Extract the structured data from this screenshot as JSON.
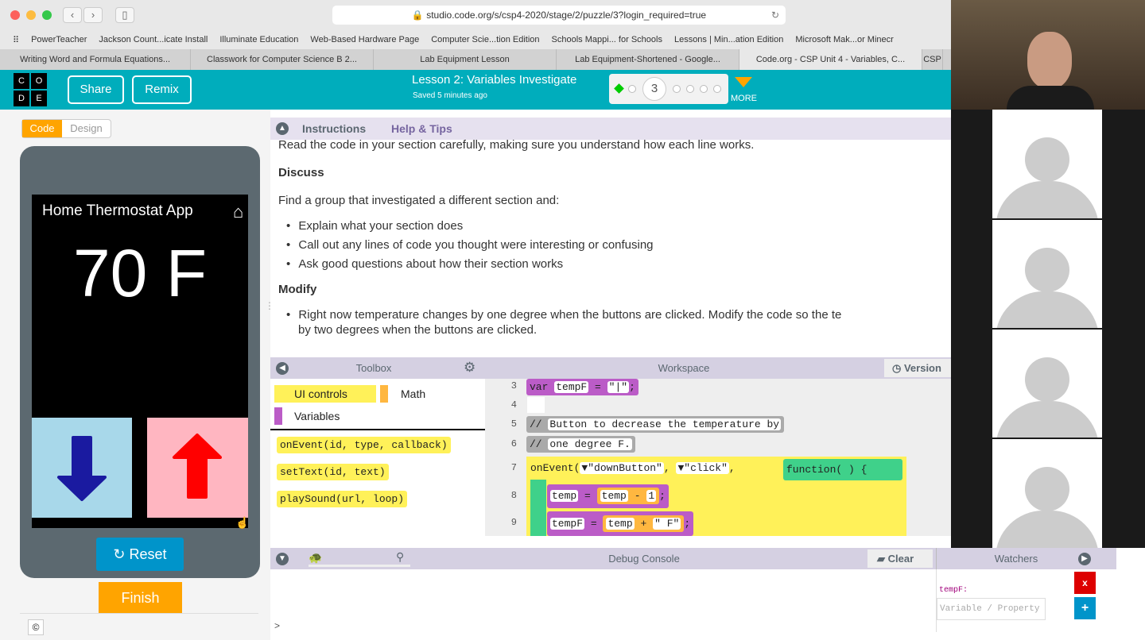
{
  "browser": {
    "url": "studio.code.org/s/csp4-2020/stage/2/puzzle/3?login_required=true",
    "bookmarks": [
      "PowerTeacher",
      "Jackson Count...icate Install",
      "Illuminate Education",
      "Web-Based Hardware Page",
      "Computer Scie...tion Edition",
      "Schools Mappi... for Schools",
      "Lessons | Min...ation Edition",
      "Microsoft Mak...or Minecr"
    ],
    "tabs": [
      "Writing Word and Formula Equations...",
      "Classwork for Computer Science B 2...",
      "Lab Equipment Lesson",
      "Lab Equipment-Shortened - Google...",
      "Code.org - CSP Unit 4 - Variables, C...",
      "CSP"
    ]
  },
  "header": {
    "logo": [
      "C",
      "O",
      "D",
      "E"
    ],
    "share": "Share",
    "remix": "Remix",
    "lesson": "Lesson 2: Variables Investigate",
    "saved": "Saved 5 minutes ago",
    "current_level": "3",
    "more": "MORE"
  },
  "left": {
    "code_tab": "Code",
    "design_tab": "Design",
    "app_title": "Home Thermostat App",
    "temperature": "70 F",
    "reset": "Reset",
    "finish": "Finish",
    "copyright": "©"
  },
  "instructions": {
    "tab1": "Instructions",
    "tab2": "Help & Tips",
    "line0": "Read the code in your section carefully, making sure you understand how each line works.",
    "discuss": "Discuss",
    "discuss_intro": "Find a group that investigated a different section and:",
    "discuss_items": [
      "Explain what your section does",
      "Call out any lines of code you thought were interesting or confusing",
      "Ask good questions about how their section works"
    ],
    "modify": "Modify",
    "modify_item_1": "Right now temperature changes by one degree when the buttons are clicked. Modify the code so the te",
    "modify_item_2": "by two degrees when the buttons are clicked."
  },
  "toolbox": {
    "title": "Toolbox",
    "categories": [
      "UI controls",
      "Math",
      "Variables"
    ],
    "blocks": [
      "onEvent(id, type, callback)",
      "setText(id, text)",
      "playSound(url, loop)"
    ]
  },
  "workspace": {
    "title": "Workspace",
    "version": "Version",
    "line_numbers": [
      "3",
      "4",
      "5",
      "6",
      "7",
      "8",
      "9"
    ],
    "l3": {
      "kw": "var",
      "name": "tempF",
      "eq": "=",
      "val": "\"|\"",
      "end": ";"
    },
    "l5": "Button to decrease the temperature by",
    "l6": "one degree F.",
    "comment": "//",
    "l7": {
      "fn": "onEvent(",
      "id": "\"downButton\"",
      "comma": ",",
      "type": "\"click\"",
      "func": "function( ) {"
    },
    "l8": {
      "lhs": "temp",
      "eq": "=",
      "a": "temp",
      "op": "-",
      "b": "1",
      "end": ";"
    },
    "l9": {
      "lhs": "tempF",
      "eq": "=",
      "a": "temp",
      "op": "+",
      "b": "\" F\"",
      "end": ";"
    }
  },
  "debug": {
    "title": "Debug Console",
    "clear": "Clear",
    "prompt": ">",
    "watchers": "Watchers",
    "watch_var": "tempF:",
    "watch_placeholder": "Variable / Property"
  },
  "colors": {
    "teal": "#00adbc",
    "orange": "#ffa400",
    "reset_blue": "#0094ca",
    "down_arrow": "#1a1aa0",
    "up_arrow": "#ff0000"
  }
}
